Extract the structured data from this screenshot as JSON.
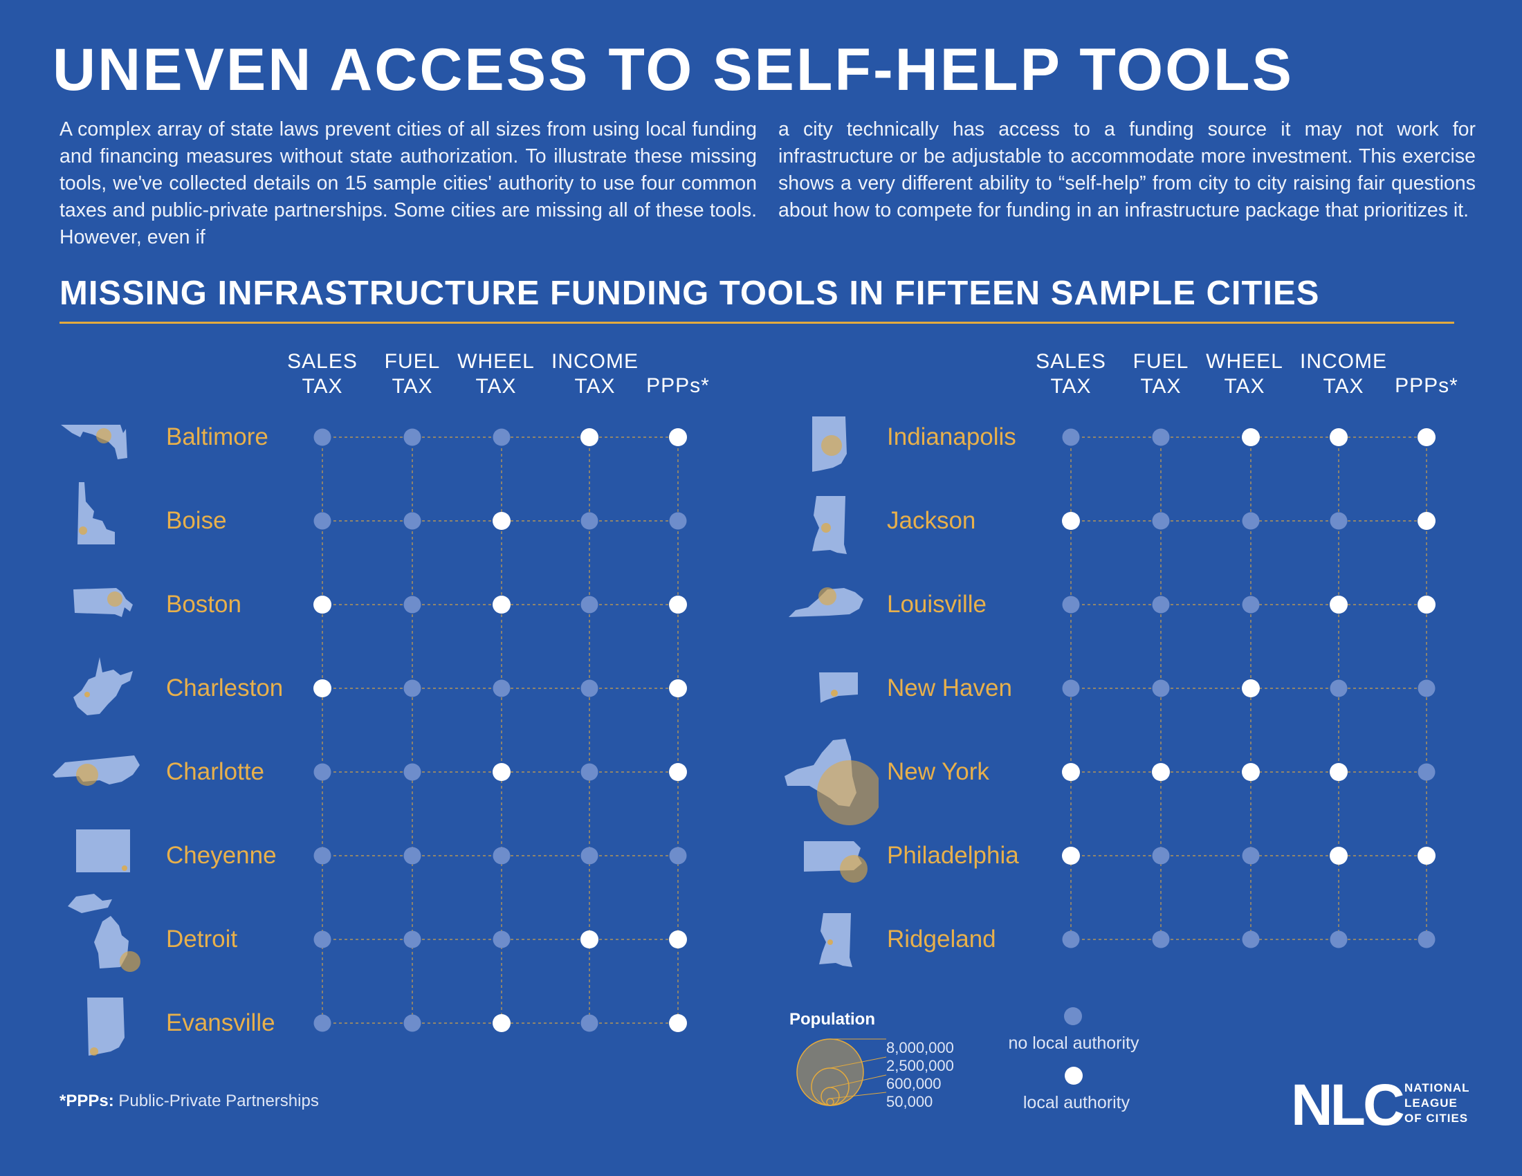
{
  "title": "UNEVEN ACCESS TO SELF-HELP TOOLS",
  "intro_left": "A complex array of state laws prevent cities of all sizes from using local funding and financing measures without state authorization. To illustrate these missing tools, we've collected details on 15 sample cities' authority to use four common taxes and public-private partnerships. Some cities are missing all of these tools. However, even if",
  "intro_right": "a city technically has access to a funding source it may not work for infrastructure or be adjustable to accommodate more investment. This exercise shows a very different ability to “self-help” from city to city raising fair questions about how to compete for funding in an infrastructure package that prioritizes it.",
  "subtitle": "MISSING INFRASTRUCTURE FUNDING TOOLS IN FIFTEEN SAMPLE CITIES",
  "colors": {
    "background": "#2756a6",
    "accent": "#e3aa3e",
    "city_label": "#e8b04b",
    "state_shape": "#9bb4e2",
    "no_authority_dot": "#6e8dcb",
    "authority_dot": "#ffffff"
  },
  "columns": [
    {
      "line1": "SALES",
      "line2": "TAX"
    },
    {
      "line1": "FUEL",
      "line2": "TAX"
    },
    {
      "line1": "WHEEL",
      "line2": "TAX"
    },
    {
      "line1": "INCOME",
      "line2": "TAX"
    },
    {
      "line1": "",
      "line2": "PPPs*"
    }
  ],
  "chart_data": {
    "type": "table",
    "columns": [
      "SALES TAX",
      "FUEL TAX",
      "WHEEL TAX",
      "INCOME TAX",
      "PPPs*"
    ],
    "value_legend": {
      "0": "no local authority",
      "1": "local authority"
    },
    "groups": [
      {
        "cities": [
          {
            "name": "Baltimore",
            "state_icon": "maryland-map-icon",
            "authority": [
              0,
              0,
              0,
              1,
              1
            ]
          },
          {
            "name": "Boise",
            "state_icon": "idaho-map-icon",
            "authority": [
              0,
              0,
              1,
              0,
              0
            ]
          },
          {
            "name": "Boston",
            "state_icon": "massachusetts-map-icon",
            "authority": [
              1,
              0,
              1,
              0,
              1
            ]
          },
          {
            "name": "Charleston",
            "state_icon": "west-virginia-map-icon",
            "authority": [
              1,
              0,
              0,
              0,
              1
            ]
          },
          {
            "name": "Charlotte",
            "state_icon": "north-carolina-map-icon",
            "authority": [
              0,
              0,
              1,
              0,
              1
            ]
          },
          {
            "name": "Cheyenne",
            "state_icon": "wyoming-map-icon",
            "authority": [
              0,
              0,
              0,
              0,
              0
            ]
          },
          {
            "name": "Detroit",
            "state_icon": "michigan-map-icon",
            "authority": [
              0,
              0,
              0,
              1,
              1
            ]
          },
          {
            "name": "Evansville",
            "state_icon": "indiana-map-icon",
            "authority": [
              0,
              0,
              1,
              0,
              1
            ]
          }
        ]
      },
      {
        "cities": [
          {
            "name": "Indianapolis",
            "state_icon": "indiana-map-icon",
            "authority": [
              0,
              0,
              1,
              1,
              1
            ]
          },
          {
            "name": "Jackson",
            "state_icon": "mississippi-map-icon",
            "authority": [
              1,
              0,
              0,
              0,
              1
            ]
          },
          {
            "name": "Louisville",
            "state_icon": "kentucky-map-icon",
            "authority": [
              0,
              0,
              0,
              1,
              1
            ]
          },
          {
            "name": "New Haven",
            "state_icon": "connecticut-map-icon",
            "authority": [
              0,
              0,
              1,
              0,
              0
            ]
          },
          {
            "name": "New York",
            "state_icon": "new-york-map-icon",
            "authority": [
              1,
              1,
              1,
              1,
              0
            ]
          },
          {
            "name": "Philadelphia",
            "state_icon": "pennsylvania-map-icon",
            "authority": [
              1,
              0,
              0,
              1,
              1
            ]
          },
          {
            "name": "Ridgeland",
            "state_icon": "mississippi-map-icon",
            "authority": [
              0,
              0,
              0,
              0,
              0
            ]
          }
        ]
      }
    ]
  },
  "legend": {
    "population_title": "Population",
    "population_values": [
      "8,000,000",
      "2,500,000",
      "600,000",
      "50,000"
    ],
    "no_authority_label": "no local authority",
    "authority_label": "local authority"
  },
  "footnote": {
    "key": "*PPPs:",
    "text": " Public-Private Partnerships"
  },
  "logo": {
    "mark": "NLC",
    "line1": "NATIONAL",
    "line2": "LEAGUE",
    "line3": "OF CITIES"
  }
}
